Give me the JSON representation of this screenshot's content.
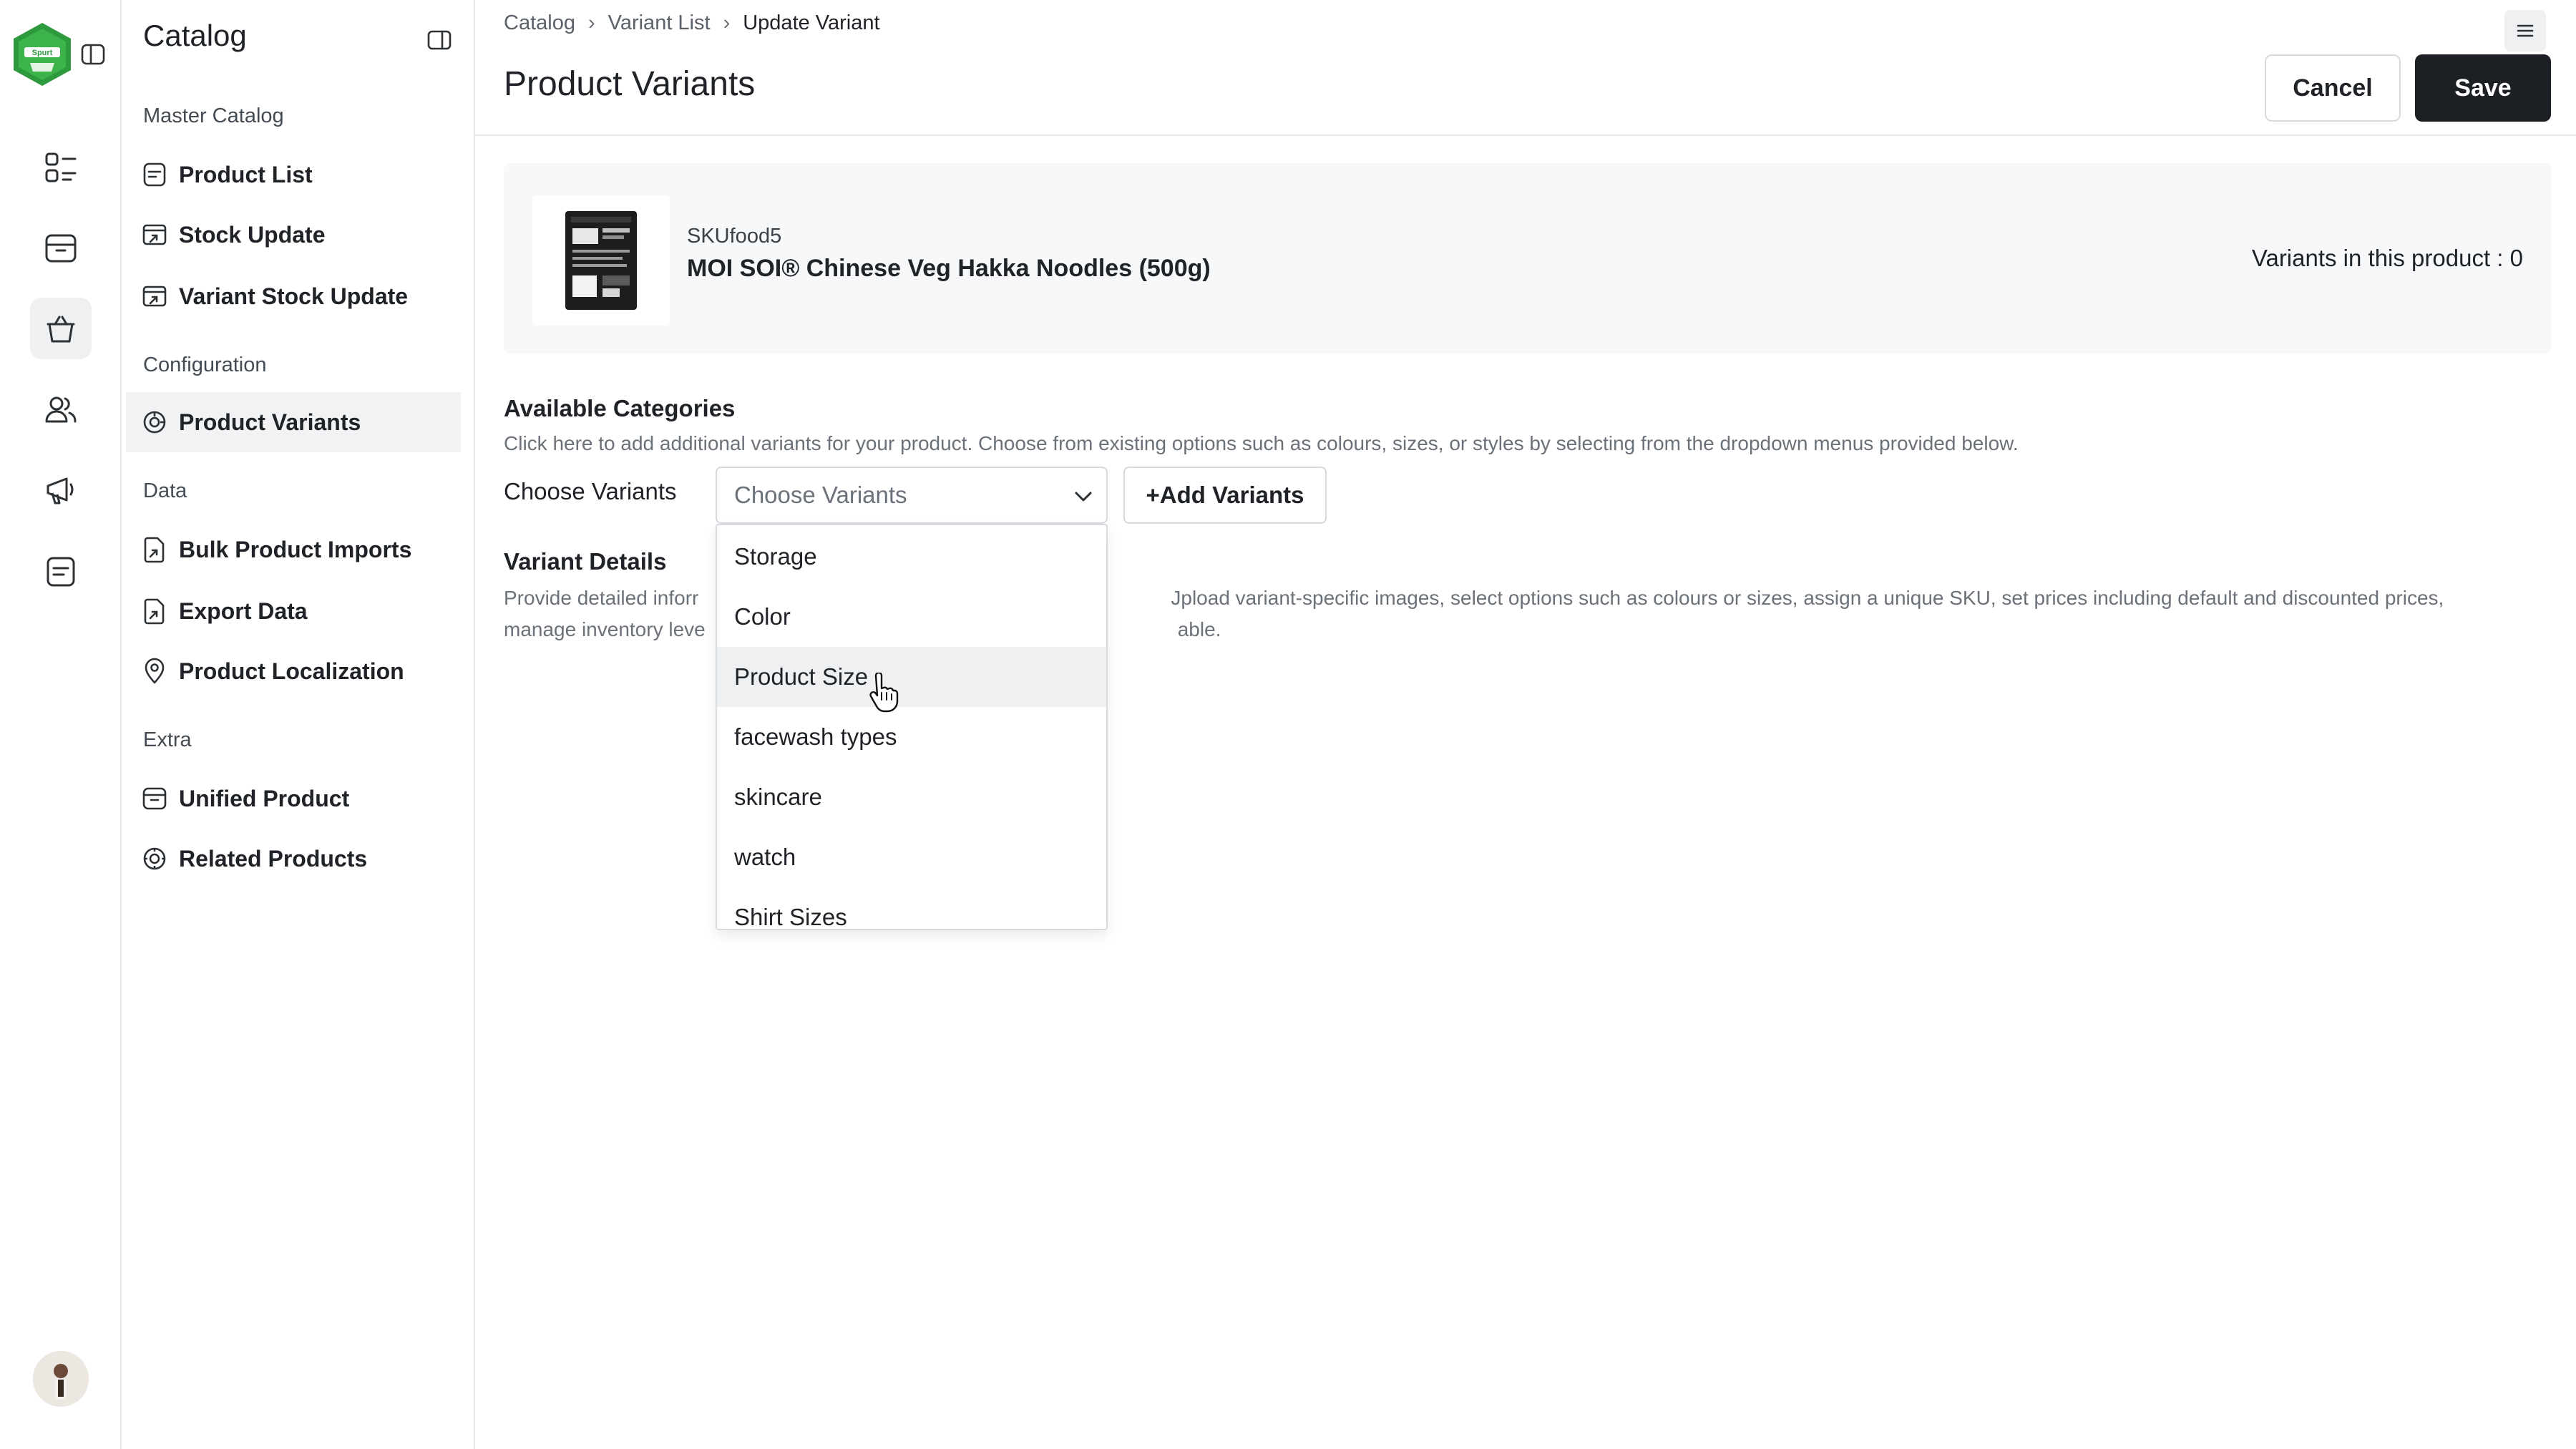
{
  "rail": {
    "logo_text": "Spurt",
    "items": [
      "dashboard",
      "orders",
      "catalog",
      "customers",
      "marketing",
      "reports"
    ],
    "active": "catalog"
  },
  "sidebar": {
    "title": "Catalog",
    "sections": [
      {
        "label": "Master Catalog"
      },
      {
        "label": "Configuration"
      },
      {
        "label": "Data"
      },
      {
        "label": "Extra"
      }
    ],
    "items": [
      {
        "label": "Product List",
        "icon": "list-icon"
      },
      {
        "label": "Stock Update",
        "icon": "stock-update-icon"
      },
      {
        "label": "Variant Stock Update",
        "icon": "stock-update-icon"
      },
      {
        "label": "Product Variants",
        "icon": "variants-icon",
        "active": true
      },
      {
        "label": "Bulk Product Imports",
        "icon": "import-icon"
      },
      {
        "label": "Export Data",
        "icon": "export-icon"
      },
      {
        "label": "Product Localization",
        "icon": "location-pin-icon"
      },
      {
        "label": "Unified Product",
        "icon": "box-icon"
      },
      {
        "label": "Related Products",
        "icon": "related-icon"
      }
    ]
  },
  "header": {
    "breadcrumb": [
      "Catalog",
      "Variant List",
      "Update Variant"
    ],
    "title": "Product Variants",
    "cancel_label": "Cancel",
    "save_label": "Save"
  },
  "product": {
    "sku": "SKUfood5",
    "name": "MOI SOI® Chinese Veg Hakka Noodles (500g)",
    "variants_count_label": "Variants in this product : 0"
  },
  "categories": {
    "title": "Available Categories",
    "description": "Click here to add additional variants for your product. Choose from existing options such as colours, sizes, or styles by selecting from the dropdown menus provided below.",
    "choose_label": "Choose Variants",
    "select_placeholder": "Choose Variants",
    "add_button": "+Add Variants",
    "dropdown_options": [
      "Storage",
      "Color",
      "Product Size",
      "facewash types",
      "skincare",
      "watch",
      "Shirt Sizes"
    ],
    "hovered_option": "Product Size"
  },
  "variant_details": {
    "title": "Variant Details",
    "description_line1_left": "Provide detailed inforr",
    "description_line1_right": "Jpload variant-specific images, select options such as colours or sizes, assign a unique SKU, set prices including default and discounted prices,",
    "description_line2_left": "manage inventory leve",
    "description_line2_right": "able."
  },
  "colors": {
    "accent_dark": "#1c1f23",
    "logo_green": "#2e9a3e",
    "border": "#d7dade"
  }
}
